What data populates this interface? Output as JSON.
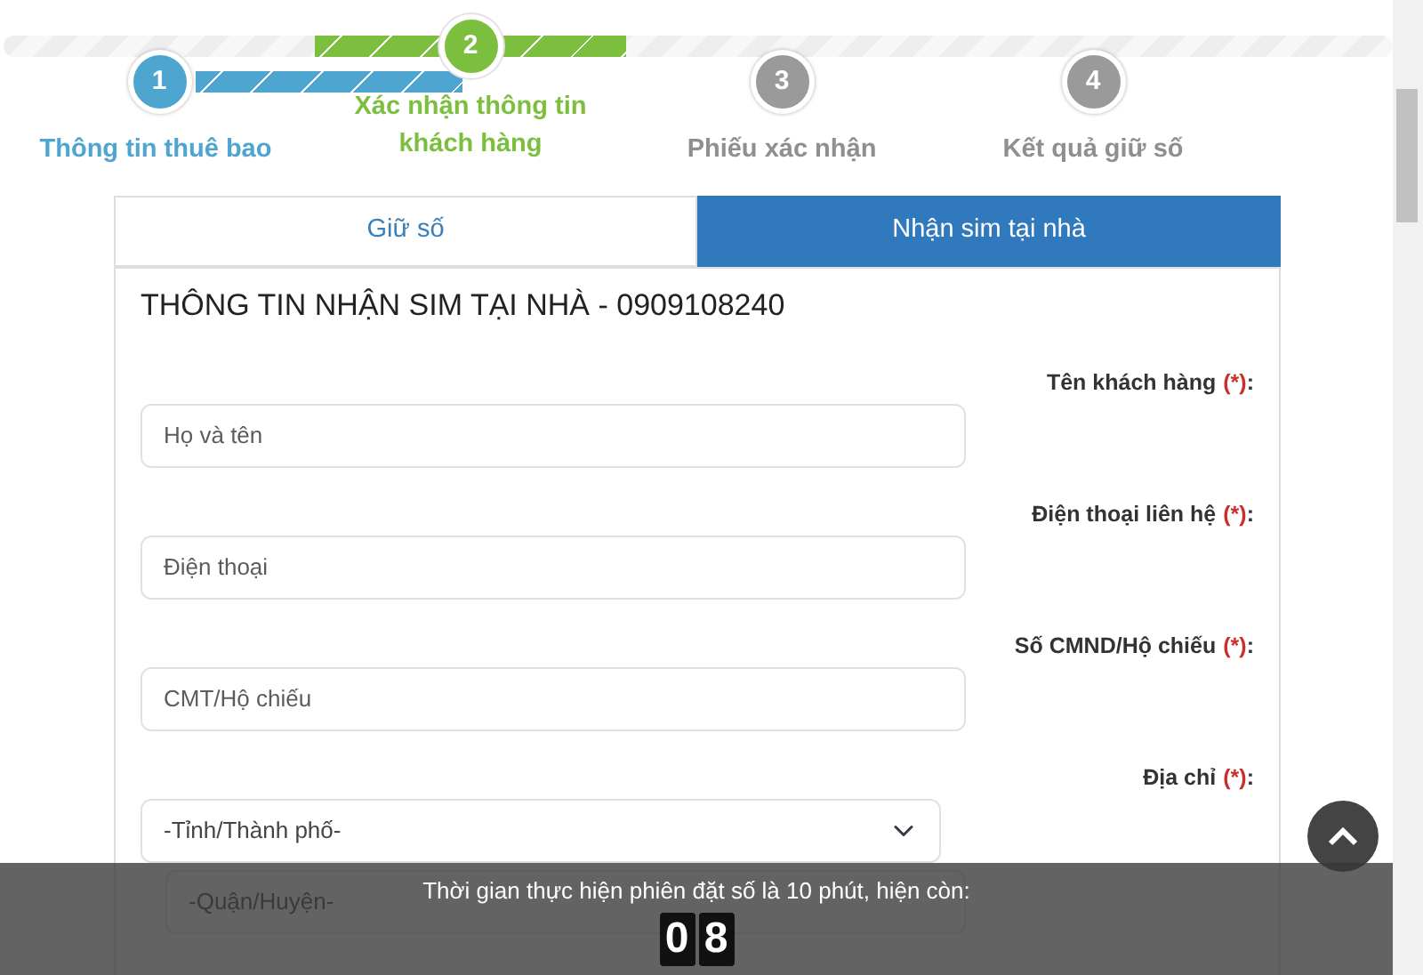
{
  "steps": [
    {
      "number": "1",
      "label": "Thông tin thuê bao",
      "completed": true,
      "selected": false
    },
    {
      "number": "2",
      "label": "Xác nhận thông tin khách hàng",
      "completed": false,
      "selected": true
    },
    {
      "number": "3",
      "label": "Phiếu xác nhận",
      "completed": false,
      "selected": false
    },
    {
      "number": "4",
      "label": "Kết quả giữ số",
      "completed": false,
      "selected": false
    }
  ],
  "tabs": [
    {
      "label": "Giữ số",
      "selected": false
    },
    {
      "label": "Nhận sim tại nhà",
      "selected": true
    }
  ],
  "form": {
    "title": "THÔNG TIN NHẬN SIM TẠI NHÀ - 0909108240",
    "fields": [
      {
        "kind": "input",
        "label": "Tên khách hàng",
        "required": "(*)",
        "separator": ":",
        "placeholder": "Họ và tên"
      },
      {
        "kind": "input",
        "label": "Điện thoại liên hệ",
        "required": "(*)",
        "separator": ":",
        "placeholder": "Điện thoại"
      },
      {
        "kind": "input",
        "label": "Số CMND/Hộ chiếu",
        "required": "(*)",
        "separator": ":",
        "placeholder": "CMT/Hộ chiếu"
      },
      {
        "kind": "selects",
        "label": "Địa chỉ",
        "required": "(*)",
        "separator": ":",
        "options": [
          "-Tỉnh/Thành phố-",
          "-Quận/Huyện-"
        ]
      }
    ]
  },
  "timer": {
    "message": "Thời gian thực hiện phiên đặt số là 10 phút, hiện còn:",
    "digits": [
      "0",
      "8"
    ]
  }
}
